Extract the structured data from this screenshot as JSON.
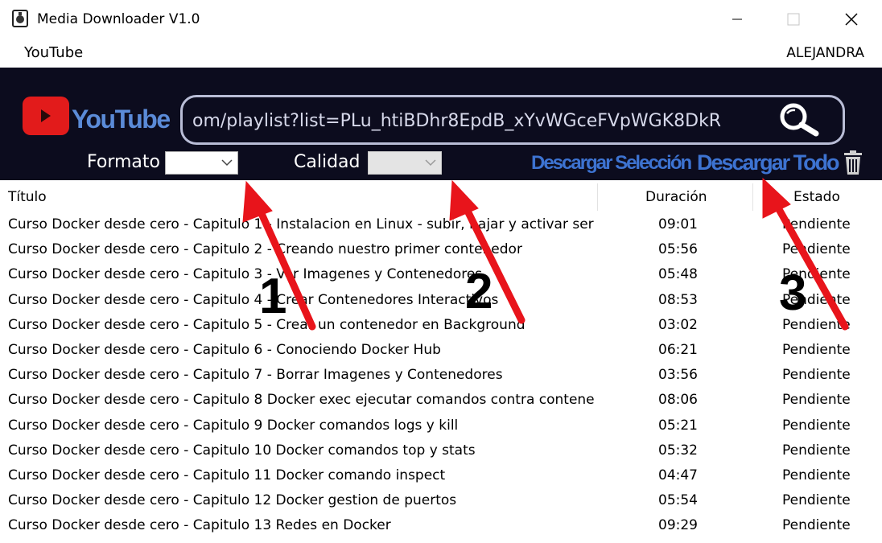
{
  "window": {
    "title": "Media Downloader V1.0",
    "icon": "music-doc-icon"
  },
  "menu": {
    "youtube": "YouTube",
    "user": "ALEJANDRA"
  },
  "header": {
    "logo_text": "YouTube",
    "url_value": "om/playlist?list=PLu_htiBDhr8EpdB_xYvWGceFVpWGK8DkR",
    "formato_label": "Formato",
    "calidad_label": "Calidad",
    "formato_value": "",
    "calidad_value": "",
    "download_selection": "Descargar Selección",
    "download_all": "Descargar Todo"
  },
  "table": {
    "columns": [
      "Título",
      "Duración",
      "Estado"
    ],
    "rows": [
      {
        "title": "Curso Docker desde cero - Capitulo 1 - Instalacion en Linux - subir, bajar y activar servicio",
        "duration": "09:01",
        "status": "Pendiente"
      },
      {
        "title": "Curso Docker desde cero - Capitulo 2 - Creando nuestro primer contenedor",
        "duration": "05:56",
        "status": "Pendiente"
      },
      {
        "title": "Curso Docker desde cero - Capitulo 3 - Ver Imagenes y Contenedores",
        "duration": "05:48",
        "status": "Pendiente"
      },
      {
        "title": "Curso Docker desde cero - Capitulo 4 - Crear Contenedores Interactivos",
        "duration": "08:53",
        "status": "Pendiente"
      },
      {
        "title": "Curso Docker desde cero - Capitulo 5 - Crear un contenedor en Background",
        "duration": "03:02",
        "status": "Pendiente"
      },
      {
        "title": "Curso Docker desde cero - Capitulo 6 - Conociendo Docker Hub",
        "duration": "06:21",
        "status": "Pendiente"
      },
      {
        "title": "Curso Docker desde cero - Capitulo 7 - Borrar Imagenes y Contenedores",
        "duration": "03:56",
        "status": "Pendiente"
      },
      {
        "title": "Curso Docker desde cero - Capitulo 8 Docker exec ejecutar comandos contra contenedores",
        "duration": "08:06",
        "status": "Pendiente"
      },
      {
        "title": "Curso Docker desde cero - Capitulo 9 Docker comandos logs y kill",
        "duration": "05:21",
        "status": "Pendiente"
      },
      {
        "title": "Curso Docker desde cero - Capitulo 10 Docker comandos top y stats",
        "duration": "05:32",
        "status": "Pendiente"
      },
      {
        "title": "Curso Docker desde cero - Capitulo 11 Docker comando inspect",
        "duration": "04:47",
        "status": "Pendiente"
      },
      {
        "title": "Curso Docker desde cero - Capitulo 12 Docker gestion de puertos",
        "duration": "05:54",
        "status": "Pendiente"
      },
      {
        "title": "Curso Docker desde cero - Capitulo 13 Redes en Docker",
        "duration": "09:29",
        "status": "Pendiente"
      }
    ]
  },
  "annotations": {
    "step_1": "1",
    "step_2": "2",
    "step_3": "3",
    "arrow_color": "#e8141b"
  },
  "colors": {
    "header_bg": "#0c0c1e",
    "accent_blue": "#3d73d1",
    "youtube_red": "#e21b1b"
  }
}
